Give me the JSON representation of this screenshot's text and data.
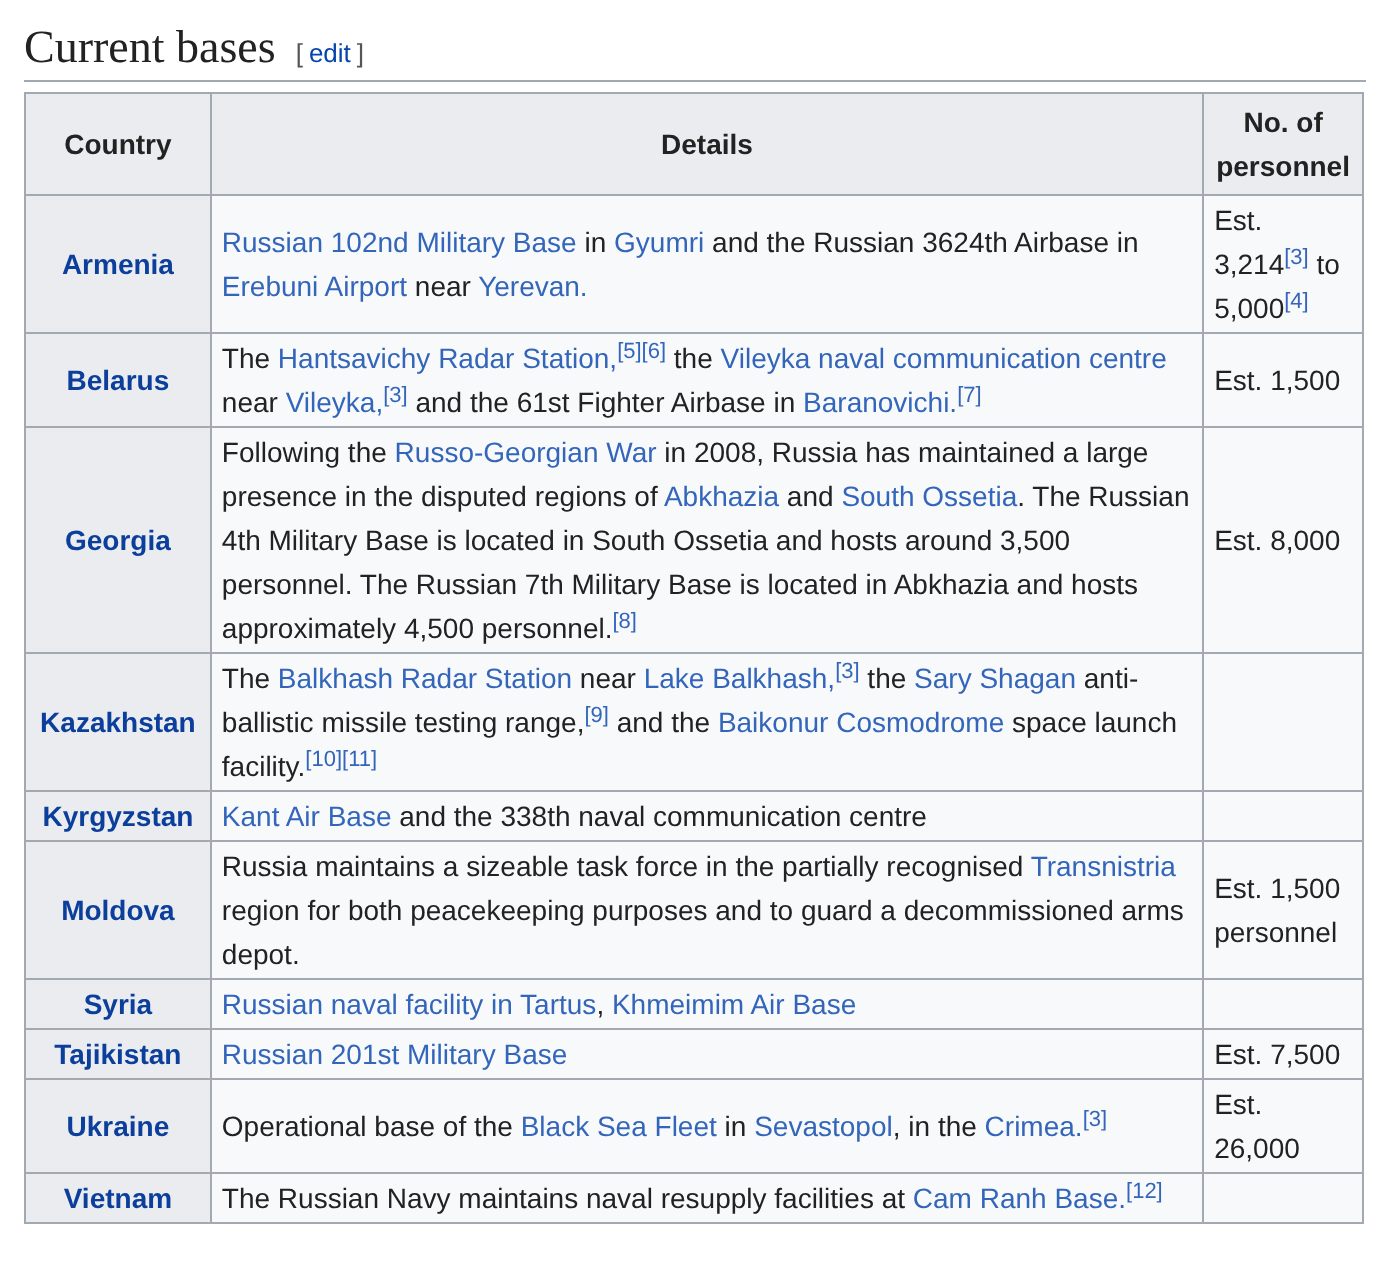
{
  "heading": {
    "title": "Current bases",
    "edit_link": "edit",
    "brackets": [
      "[",
      "]"
    ]
  },
  "table": {
    "columns": [
      "Country",
      "Details",
      "No. of personnel"
    ],
    "rows": [
      {
        "country": "Armenia",
        "details": [
          {
            "kind": "link",
            "text": "Russian 102nd Military Base"
          },
          {
            "kind": "text",
            "text": " in "
          },
          {
            "kind": "link",
            "text": "Gyumri"
          },
          {
            "kind": "text",
            "text": " and the Russian 3624th Airbase in "
          },
          {
            "kind": "link",
            "text": "Erebuni Airport"
          },
          {
            "kind": "text",
            "text": " near "
          },
          {
            "kind": "link",
            "text": "Yerevan."
          }
        ],
        "personnel": [
          {
            "kind": "text",
            "text": "Est. 3,214"
          },
          {
            "kind": "ref",
            "text": "[3]"
          },
          {
            "kind": "text",
            "text": " to 5,000"
          },
          {
            "kind": "ref",
            "text": "[4]"
          }
        ]
      },
      {
        "country": "Belarus",
        "details": [
          {
            "kind": "text",
            "text": "The "
          },
          {
            "kind": "link",
            "text": "Hantsavichy Radar Station,"
          },
          {
            "kind": "ref",
            "text": "[5]"
          },
          {
            "kind": "ref",
            "text": "[6]"
          },
          {
            "kind": "text",
            "text": " the "
          },
          {
            "kind": "link",
            "text": "Vileyka naval communication centre"
          },
          {
            "kind": "text",
            "text": " near "
          },
          {
            "kind": "link",
            "text": "Vileyka,"
          },
          {
            "kind": "ref",
            "text": "[3]"
          },
          {
            "kind": "text",
            "text": " and the 61st Fighter Airbase in "
          },
          {
            "kind": "link",
            "text": "Baranovichi."
          },
          {
            "kind": "ref",
            "text": "[7]"
          }
        ],
        "personnel": [
          {
            "kind": "text",
            "text": "Est. 1,500"
          }
        ]
      },
      {
        "country": "Georgia",
        "details": [
          {
            "kind": "text",
            "text": "Following the "
          },
          {
            "kind": "link",
            "text": "Russo-Georgian War"
          },
          {
            "kind": "text",
            "text": " in 2008, Russia has maintained a large presence in the disputed regions of "
          },
          {
            "kind": "link",
            "text": "Abkhazia"
          },
          {
            "kind": "text",
            "text": " and "
          },
          {
            "kind": "link",
            "text": "South Ossetia"
          },
          {
            "kind": "text",
            "text": ". The Russian 4th Military Base is located in South Ossetia and hosts around 3,500 personnel. The Russian 7th Military Base is located in Abkhazia and hosts approximately 4,500 personnel."
          },
          {
            "kind": "ref",
            "text": "[8]"
          }
        ],
        "personnel": [
          {
            "kind": "text",
            "text": "Est. 8,000"
          }
        ]
      },
      {
        "country": "Kazakhstan",
        "details": [
          {
            "kind": "text",
            "text": "The "
          },
          {
            "kind": "link",
            "text": "Balkhash Radar Station"
          },
          {
            "kind": "text",
            "text": " near "
          },
          {
            "kind": "link",
            "text": "Lake Balkhash,"
          },
          {
            "kind": "ref",
            "text": "[3]"
          },
          {
            "kind": "text",
            "text": " the "
          },
          {
            "kind": "link",
            "text": "Sary Shagan"
          },
          {
            "kind": "text",
            "text": " anti-ballistic missile testing range,"
          },
          {
            "kind": "ref",
            "text": "[9]"
          },
          {
            "kind": "text",
            "text": " and the "
          },
          {
            "kind": "link",
            "text": "Baikonur Cosmodrome"
          },
          {
            "kind": "text",
            "text": " space launch facility."
          },
          {
            "kind": "ref",
            "text": "[10]"
          },
          {
            "kind": "ref",
            "text": "[11]"
          }
        ],
        "personnel": []
      },
      {
        "country": "Kyrgyzstan",
        "details": [
          {
            "kind": "link",
            "text": "Kant Air Base"
          },
          {
            "kind": "text",
            "text": " and the 338th naval communication centre"
          }
        ],
        "personnel": []
      },
      {
        "country": "Moldova",
        "details": [
          {
            "kind": "text",
            "text": "Russia maintains a sizeable task force in the partially recognised "
          },
          {
            "kind": "link",
            "text": "Transnistria"
          },
          {
            "kind": "text",
            "text": " region for both peacekeeping purposes and to guard a decommissioned arms depot."
          }
        ],
        "personnel": [
          {
            "kind": "text",
            "text": "Est. 1,500 personnel"
          }
        ]
      },
      {
        "country": "Syria",
        "details": [
          {
            "kind": "link",
            "text": "Russian naval facility in Tartus"
          },
          {
            "kind": "text",
            "text": ", "
          },
          {
            "kind": "link",
            "text": "Khmeimim Air Base"
          }
        ],
        "personnel": []
      },
      {
        "country": "Tajikistan",
        "details": [
          {
            "kind": "link",
            "text": "Russian 201st Military Base"
          }
        ],
        "personnel": [
          {
            "kind": "text",
            "text": "Est. 7,500"
          }
        ]
      },
      {
        "country": "Ukraine",
        "details": [
          {
            "kind": "text",
            "text": "Operational base of the "
          },
          {
            "kind": "link",
            "text": "Black Sea Fleet"
          },
          {
            "kind": "text",
            "text": " in "
          },
          {
            "kind": "link",
            "text": "Sevastopol"
          },
          {
            "kind": "text",
            "text": ", in the "
          },
          {
            "kind": "link",
            "text": "Crimea."
          },
          {
            "kind": "ref",
            "text": "[3]"
          }
        ],
        "personnel": [
          {
            "kind": "text",
            "text": "Est. 26,000"
          }
        ]
      },
      {
        "country": "Vietnam",
        "details": [
          {
            "kind": "text",
            "text": "The Russian Navy maintains naval resupply facilities at "
          },
          {
            "kind": "link",
            "text": "Cam Ranh Base."
          },
          {
            "kind": "ref",
            "text": "[12]"
          }
        ],
        "personnel": []
      }
    ]
  }
}
